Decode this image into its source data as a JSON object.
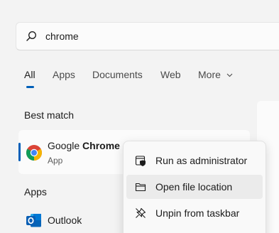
{
  "search": {
    "value": "chrome",
    "icon": "search-icon"
  },
  "tabs": [
    {
      "label": "All",
      "active": true
    },
    {
      "label": "Apps"
    },
    {
      "label": "Documents"
    },
    {
      "label": "Web"
    },
    {
      "label": "More"
    }
  ],
  "best_match": {
    "title": "Best match",
    "app": {
      "name_prefix": "Google ",
      "name_bold": "Chrome",
      "type": "App",
      "icon": "chrome-icon"
    }
  },
  "apps": {
    "title": "Apps",
    "items": [
      {
        "name": "Outlook",
        "icon": "outlook-icon"
      }
    ]
  },
  "context_menu": {
    "items": [
      {
        "label": "Run as administrator",
        "icon": "shield-icon"
      },
      {
        "label": "Open file location",
        "icon": "folder-icon",
        "hovered": true
      },
      {
        "label": "Unpin from taskbar",
        "icon": "unpin-icon"
      }
    ]
  },
  "colors": {
    "accent": "#005fb8",
    "background": "#f3f3f3"
  }
}
